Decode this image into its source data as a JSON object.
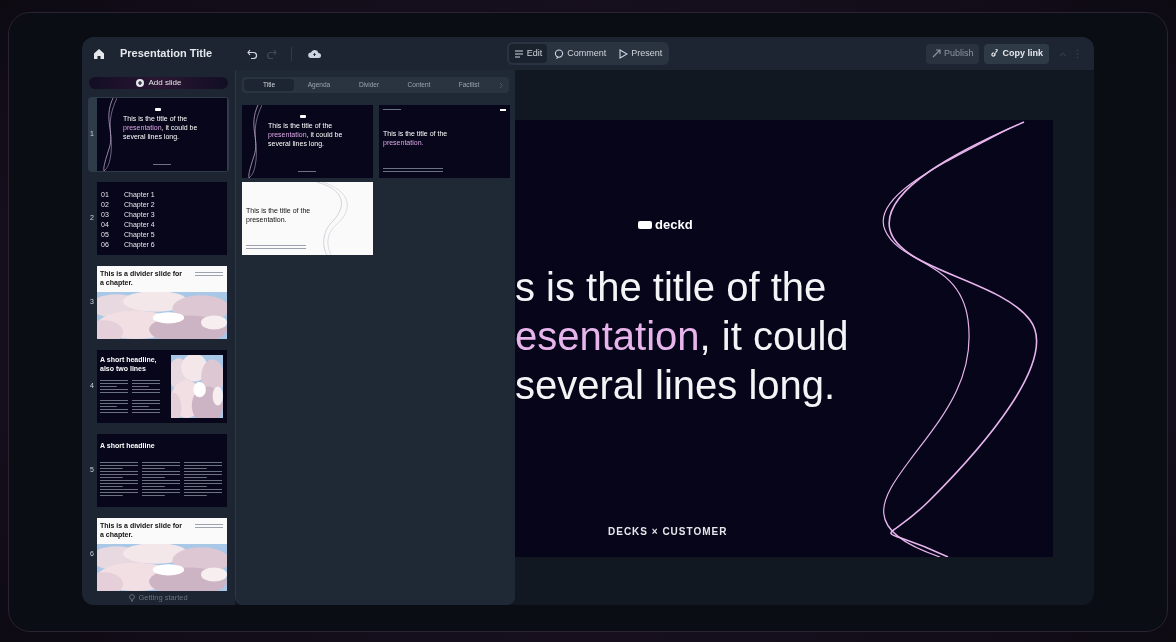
{
  "toolbar": {
    "title": "Presentation Title",
    "modes": [
      {
        "label": "Edit",
        "selected": true
      },
      {
        "label": "Comment",
        "selected": false
      },
      {
        "label": "Present",
        "selected": false
      }
    ],
    "publish": {
      "label": "Publish",
      "disabled": true
    },
    "copy_link": {
      "label": "Copy link"
    }
  },
  "sidebar": {
    "add_slide": "Add slide",
    "footer": "Getting started",
    "slides": [
      {
        "number": "1",
        "kind": "title",
        "selected": true,
        "title": [
          {
            "text": "This is the title of the "
          },
          {
            "text": "presentation",
            "accent": true
          },
          {
            "text": ", it could be several lines long."
          }
        ]
      },
      {
        "number": "2",
        "kind": "agenda",
        "selected": false,
        "items": [
          {
            "index": "01",
            "label": "Chapter 1"
          },
          {
            "index": "02",
            "label": "Chapter 2"
          },
          {
            "index": "03",
            "label": "Chapter 3"
          },
          {
            "index": "04",
            "label": "Chapter 4"
          },
          {
            "index": "05",
            "label": "Chapter 5"
          },
          {
            "index": "06",
            "label": "Chapter 6"
          }
        ]
      },
      {
        "number": "3",
        "kind": "divider",
        "selected": false,
        "title": [
          {
            "text": "This is a divider slide for a chapter."
          }
        ]
      },
      {
        "number": "4",
        "kind": "split",
        "selected": false,
        "title": [
          {
            "text": "A short headline, also two lines"
          }
        ]
      },
      {
        "number": "5",
        "kind": "columns",
        "selected": false,
        "title": [
          {
            "text": "A short headline"
          }
        ]
      },
      {
        "number": "6",
        "kind": "divider",
        "selected": false,
        "title": [
          {
            "text": "This is a divider slide for a chapter."
          }
        ]
      }
    ]
  },
  "layout_picker": {
    "tabs": [
      {
        "label": "Title",
        "selected": true
      },
      {
        "label": "Agenda",
        "selected": false
      },
      {
        "label": "Divider",
        "selected": false
      },
      {
        "label": "Content",
        "selected": false
      },
      {
        "label": "Factlist",
        "selected": false
      }
    ],
    "layouts": [
      {
        "kind": "title",
        "title": [
          {
            "text": "This is the title of the "
          },
          {
            "text": "presentation",
            "accent": true
          },
          {
            "text": ", it could be several lines long."
          }
        ]
      },
      {
        "kind": "title-left",
        "title": [
          {
            "text": "This is the title of the "
          },
          {
            "text": "presentation.",
            "accent": true
          }
        ]
      },
      {
        "kind": "title-light",
        "title": [
          {
            "text": "This is the title of the presentation."
          }
        ]
      }
    ]
  },
  "canvas": {
    "logo": "deckd",
    "footer": "DECKS × CUSTOMER",
    "title_lines": [
      [
        {
          "text": "s is the title of the"
        }
      ],
      [
        {
          "text": "esentation",
          "accent": true
        },
        {
          "text": ", it could"
        }
      ],
      [
        {
          "text": "several lines long."
        }
      ]
    ]
  }
}
